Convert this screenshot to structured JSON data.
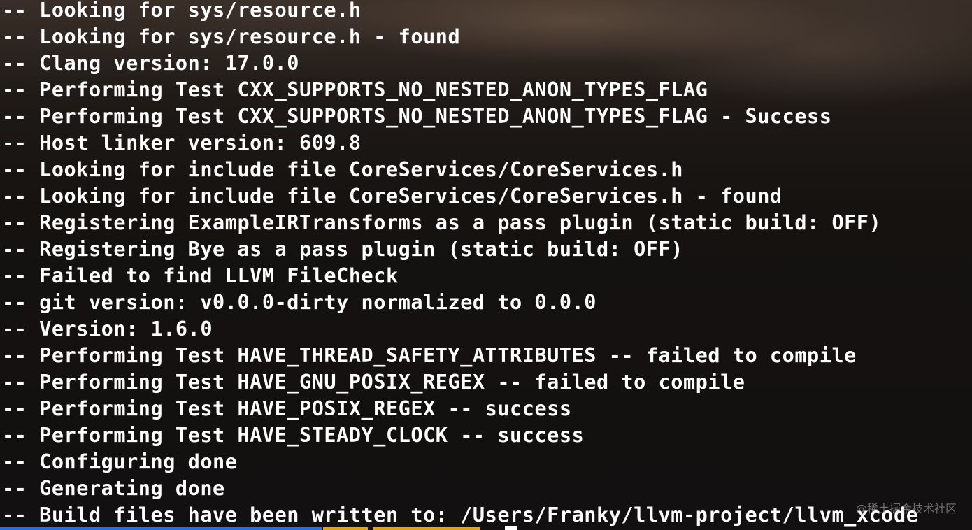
{
  "terminal": {
    "lines": [
      "-- Looking for sys/resource.h",
      "-- Looking for sys/resource.h - found",
      "-- Clang version: 17.0.0",
      "-- Performing Test CXX_SUPPORTS_NO_NESTED_ANON_TYPES_FLAG",
      "-- Performing Test CXX_SUPPORTS_NO_NESTED_ANON_TYPES_FLAG - Success",
      "-- Host linker version: 609.8",
      "-- Looking for include file CoreServices/CoreServices.h",
      "-- Looking for include file CoreServices/CoreServices.h - found",
      "-- Registering ExampleIRTransforms as a pass plugin (static build: OFF)",
      "-- Registering Bye as a pass plugin (static build: OFF)",
      "-- Failed to find LLVM FileCheck",
      "-- git version: v0.0.0-dirty normalized to 0.0.0",
      "-- Version: 1.6.0",
      "-- Performing Test HAVE_THREAD_SAFETY_ATTRIBUTES -- failed to compile",
      "-- Performing Test HAVE_GNU_POSIX_REGEX -- failed to compile",
      "-- Performing Test HAVE_POSIX_REGEX -- success",
      "-- Performing Test HAVE_STEADY_CLOCK -- success",
      "-- Configuring done",
      "-- Generating done",
      "-- Build files have been written to: /Users/Franky/llvm-project/llvm_xcode"
    ],
    "text_color": "#ffffff",
    "background_color": "#14110f"
  },
  "watermark": {
    "text": "@稀土掘金技术社区"
  },
  "status_bar": {
    "colors": [
      "#2f6fd6",
      "#d8a623"
    ]
  }
}
